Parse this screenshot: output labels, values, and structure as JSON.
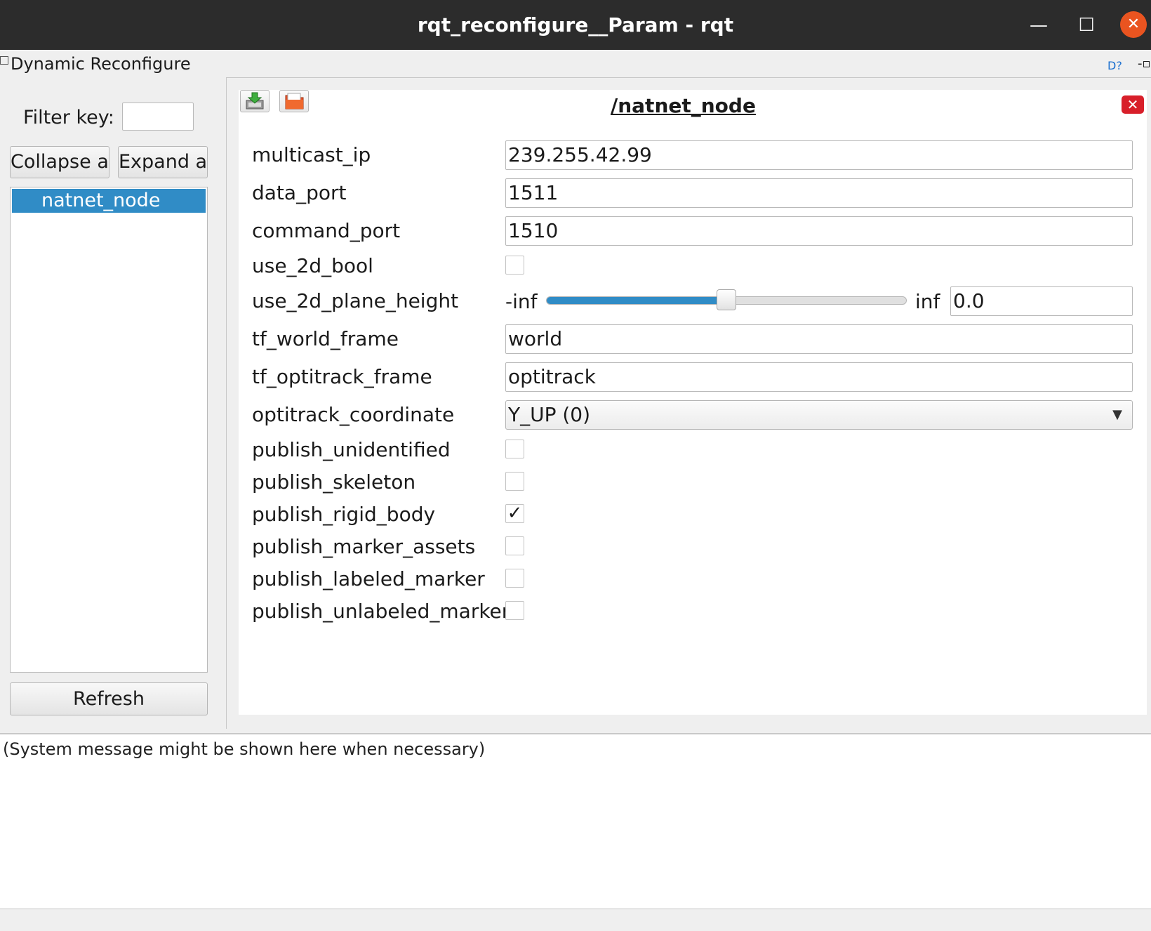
{
  "window": {
    "title": "rqt_reconfigure__Param - rqt",
    "minimize_glyph": "—",
    "maximize_glyph": "☐",
    "close_glyph": "✕"
  },
  "plugin": {
    "title": "Dynamic Reconfigure",
    "help_glyph": "D?",
    "float_glyph": "-▫"
  },
  "sidebar": {
    "filter_label": "Filter key:",
    "filter_value": "",
    "collapse_label": "Collapse all",
    "expand_label": "Expand all",
    "nodes": [
      {
        "name": "natnet_node",
        "selected": true
      }
    ],
    "refresh_label": "Refresh"
  },
  "editor": {
    "node_title": "/natnet_node",
    "close_glyph": "✕",
    "save_icon": "save-icon",
    "load_icon": "folder-open-icon",
    "params": {
      "multicast_ip": {
        "label": "multicast_ip",
        "value": "239.255.42.99"
      },
      "data_port": {
        "label": "data_port",
        "value": "1511"
      },
      "command_port": {
        "label": "command_port",
        "value": "1510"
      },
      "use_2d_bool": {
        "label": "use_2d_bool",
        "checked": false
      },
      "use_2d_plane_height": {
        "label": "use_2d_plane_height",
        "min_label": "-inf",
        "max_label": "inf",
        "value": "0.0",
        "slider_fraction": 0.5
      },
      "tf_world_frame": {
        "label": "tf_world_frame",
        "value": "world"
      },
      "tf_optitrack_frame": {
        "label": "tf_optitrack_frame",
        "value": "optitrack"
      },
      "optitrack_coordinate": {
        "label": "optitrack_coordinate",
        "value": "Y_UP (0)"
      },
      "publish_unidentified": {
        "label": "publish_unidentified",
        "checked": false
      },
      "publish_skeleton": {
        "label": "publish_skeleton",
        "checked": false
      },
      "publish_rigid_body": {
        "label": "publish_rigid_body",
        "checked": true
      },
      "publish_marker_assets": {
        "label": "publish_marker_assets",
        "checked": false
      },
      "publish_labeled_marker": {
        "label": "publish_labeled_marker",
        "checked": false
      },
      "publish_unlabeled_marker": {
        "label": "publish_unlabeled_marker",
        "checked": false
      }
    },
    "check_glyph": "✓",
    "dropdown_glyph": "▼"
  },
  "status": {
    "message": "(System message might be shown here when necessary)"
  },
  "colors": {
    "titlebar": "#2c2c2c",
    "selection": "#308cc6",
    "close_button": "#e95420",
    "node_close": "#d81f2a"
  }
}
